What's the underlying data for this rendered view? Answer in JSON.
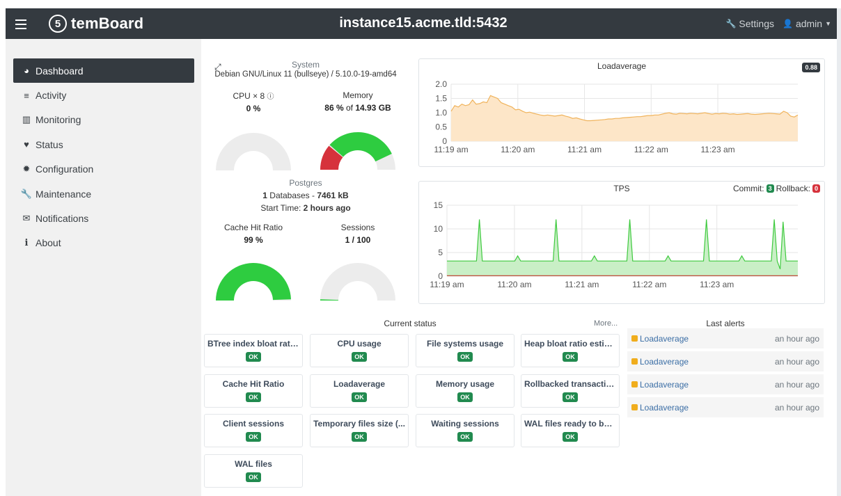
{
  "header": {
    "brand": "temBoard",
    "brand_logo_glyph": "5",
    "instance": "instance15.acme.tld:5432",
    "settings_label": "Settings",
    "user_label": "admin"
  },
  "sidebar": {
    "items": [
      {
        "label": "Dashboard",
        "icon": "tachometer-icon",
        "glyph": "◕",
        "active": true
      },
      {
        "label": "Activity",
        "icon": "list-icon",
        "glyph": "≡",
        "active": false
      },
      {
        "label": "Monitoring",
        "icon": "bar-chart-icon",
        "glyph": "▥",
        "active": false
      },
      {
        "label": "Status",
        "icon": "heart-icon",
        "glyph": "♥",
        "active": false
      },
      {
        "label": "Configuration",
        "icon": "gear-icon",
        "glyph": "✹",
        "active": false
      },
      {
        "label": "Maintenance",
        "icon": "wrench-icon",
        "glyph": "🔧",
        "active": false
      },
      {
        "label": "Notifications",
        "icon": "envelope-icon",
        "glyph": "✉",
        "active": false
      },
      {
        "label": "About",
        "icon": "info-icon",
        "glyph": "i",
        "active": false
      }
    ]
  },
  "system": {
    "title": "System",
    "description": "Debian GNU/Linux 11 (bullseye) / 5.10.0-19-amd64",
    "cpu": {
      "label": "CPU × 8",
      "value": "0 %",
      "percent": 0
    },
    "memory": {
      "label": "Memory",
      "value_pct": "86 %",
      "value_of": " of ",
      "value_total": "14.93 GB",
      "used_red_fraction": 0.22,
      "used_green_fraction": 0.64
    }
  },
  "postgres": {
    "title": "Postgres",
    "db_count": "1",
    "db_text": " Databases - ",
    "db_size": "7461 kB",
    "start_label": "Start Time: ",
    "start_value": "2 hours ago",
    "cache": {
      "label": "Cache Hit Ratio",
      "value": "99 %",
      "percent": 99
    },
    "sessions": {
      "label": "Sessions",
      "value": "1 / 100",
      "percent": 1
    }
  },
  "loadavg": {
    "title": "Loadaverage",
    "badge": "0.88",
    "y_ticks": [
      "2.0",
      "1.5",
      "1.0",
      "0.5",
      "0"
    ],
    "x_ticks": [
      "11:19 am",
      "11:20 am",
      "11:21 am",
      "11:22 am",
      "11:23 am"
    ]
  },
  "tps": {
    "title": "TPS",
    "commit_label": "Commit:",
    "commit_value": "3",
    "rollback_label": "Rollback:",
    "rollback_value": "0",
    "y_ticks": [
      "15",
      "10",
      "5",
      "0"
    ],
    "x_ticks": [
      "11:19 am",
      "11:20 am",
      "11:21 am",
      "11:22 am",
      "11:23 am"
    ]
  },
  "current_status": {
    "title": "Current status",
    "more": "More...",
    "checks": [
      {
        "name": "BTree index bloat rati...",
        "status": "OK"
      },
      {
        "name": "CPU usage",
        "status": "OK"
      },
      {
        "name": "File systems usage",
        "status": "OK"
      },
      {
        "name": "Heap bloat ratio estim...",
        "status": "OK"
      },
      {
        "name": "Cache Hit Ratio",
        "status": "OK"
      },
      {
        "name": "Loadaverage",
        "status": "OK"
      },
      {
        "name": "Memory usage",
        "status": "OK"
      },
      {
        "name": "Rollbacked transactio...",
        "status": "OK"
      },
      {
        "name": "Client sessions",
        "status": "OK"
      },
      {
        "name": "Temporary files size (...",
        "status": "OK"
      },
      {
        "name": "Waiting sessions",
        "status": "OK"
      },
      {
        "name": "WAL files ready to be ...",
        "status": "OK"
      },
      {
        "name": "WAL files",
        "status": "OK"
      }
    ]
  },
  "alerts": {
    "title": "Last alerts",
    "items": [
      {
        "name": "Loadaverage",
        "time": "an hour ago"
      },
      {
        "name": "Loadaverage",
        "time": "an hour ago"
      },
      {
        "name": "Loadaverage",
        "time": "an hour ago"
      },
      {
        "name": "Loadaverage",
        "time": "an hour ago"
      }
    ]
  },
  "colors": {
    "green": "#2ecc40",
    "red": "#d6323c",
    "grey": "#ececec",
    "load_line": "#f0b35b",
    "load_fill": "#fde6c8",
    "tps_line": "#3fca3f",
    "tps_fill": "#c9efc6",
    "rollback_line": "#c0392b"
  }
}
